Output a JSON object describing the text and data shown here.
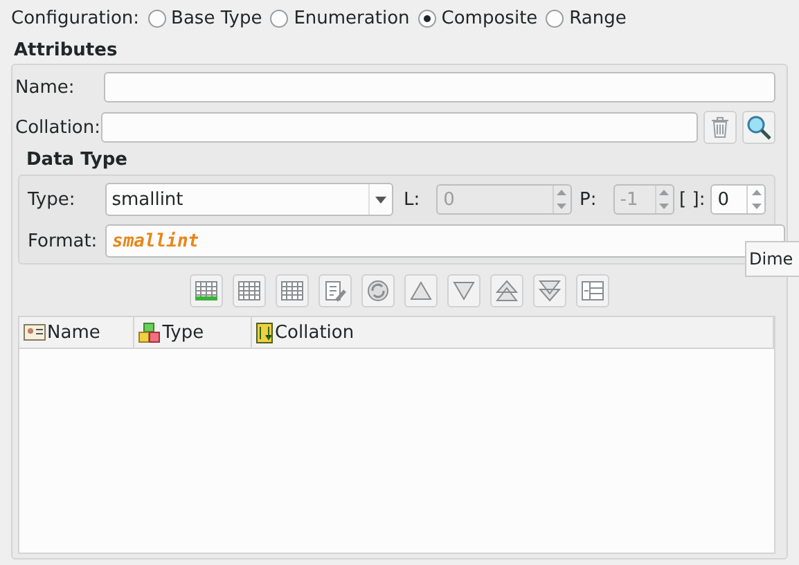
{
  "configuration": {
    "label": "Configuration:",
    "options": [
      {
        "label": "Base Type",
        "selected": false
      },
      {
        "label": "Enumeration",
        "selected": false
      },
      {
        "label": "Composite",
        "selected": true
      },
      {
        "label": "Range",
        "selected": false
      }
    ]
  },
  "attributes": {
    "title": "Attributes",
    "name_label": "Name:",
    "collation_label": "Collation:"
  },
  "data_type": {
    "title": "Data Type",
    "type_label": "Type:",
    "type_value": "smallint",
    "l_label": "L:",
    "l_value": "0",
    "l_disabled": true,
    "p_label": "P:",
    "p_value": "-1",
    "p_disabled": true,
    "dim_label": "[ ]:",
    "dim_value": "0",
    "dim_disabled": false,
    "format_label": "Format:",
    "format_value": "smallint"
  },
  "tooltip": "Dime",
  "toolbar": [
    {
      "kind": "add"
    },
    {
      "kind": "table"
    },
    {
      "kind": "table"
    },
    {
      "kind": "edit"
    },
    {
      "kind": "refresh"
    },
    {
      "kind": "up"
    },
    {
      "kind": "down"
    },
    {
      "kind": "top"
    },
    {
      "kind": "bottom"
    },
    {
      "kind": "move"
    }
  ],
  "table": {
    "columns": [
      {
        "label": "Name",
        "kind": "name"
      },
      {
        "label": "Type",
        "kind": "type"
      },
      {
        "label": "Collation",
        "kind": "collation"
      }
    ]
  }
}
